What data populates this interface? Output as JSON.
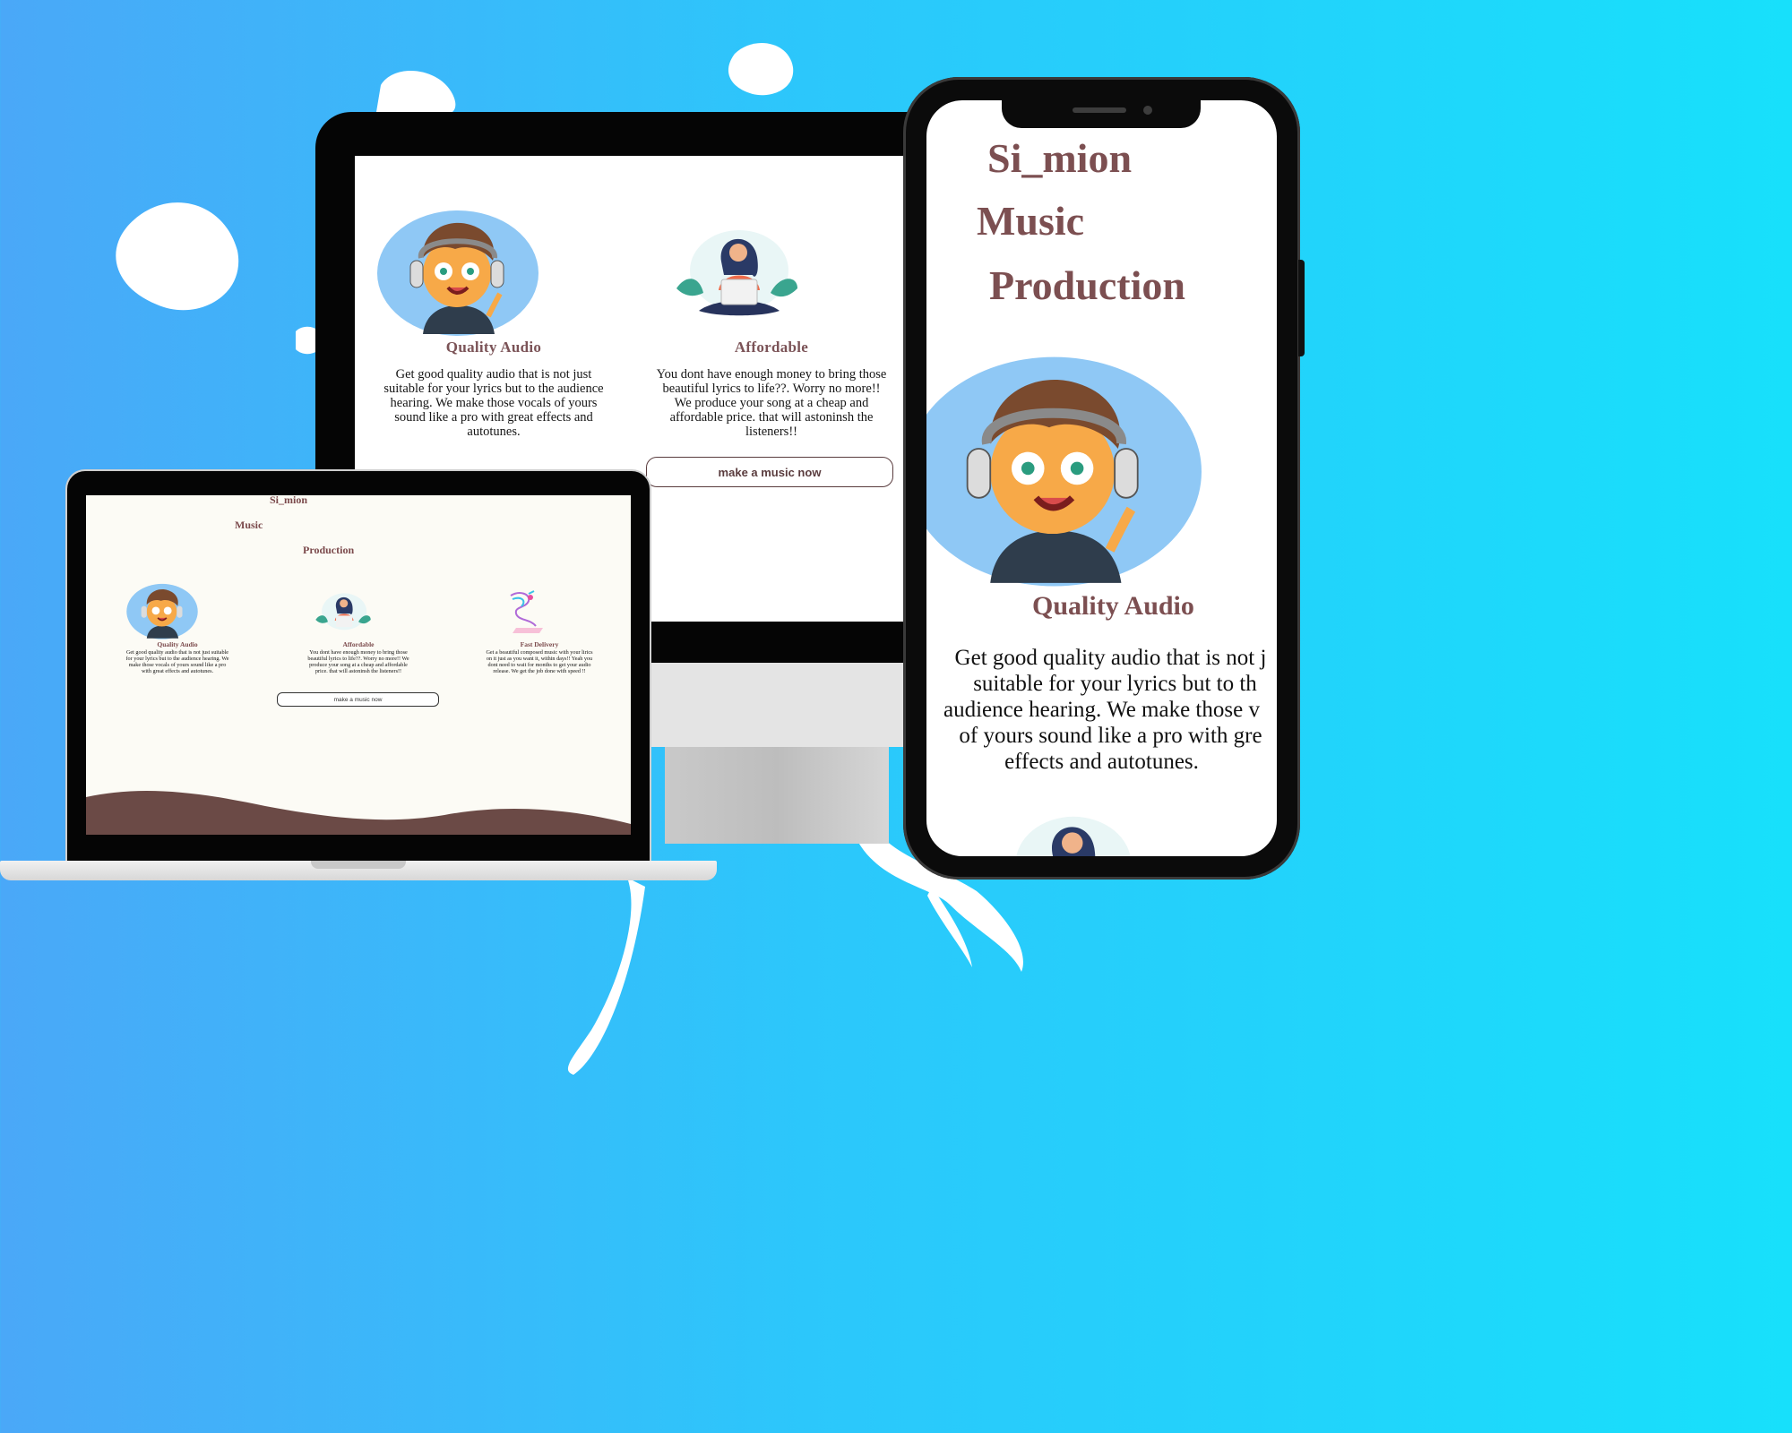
{
  "brand": {
    "line1": "Si_mion",
    "line2": "Music",
    "line3": "Production"
  },
  "features": [
    {
      "title": "Quality Audio",
      "text": "Get good quality audio that is not just suitable for your lyrics but to the audience hearing. We make those vocals of yours sound like a pro with great effects and autotunes."
    },
    {
      "title": "Affordable",
      "text": "You dont have enough money to bring those beautiful lyrics to life??. Worry no more!! We produce your song at a cheap and affordable price. that will astoninsh the listeners!!"
    },
    {
      "title": "Fast Delivery",
      "text": "Get a beautiful composed music with your lirics on it just as you want it, within days!! Yeah you dont need to wait for months to get your audio release. We get the job done with speed !!"
    }
  ],
  "cta": {
    "label": "make a music now"
  },
  "phone": {
    "feature_text_lines": [
      "Get good quality audio that is not j",
      "suitable for your lyrics but to th",
      "audience hearing. We make those v",
      "of yours sound like a pro with gre",
      "effects and autotunes."
    ]
  },
  "colors": {
    "background_left": "#4aa8f8",
    "background_right": "#17e0fb",
    "heading": "#7b5357",
    "footer_wave": "#6b4a46"
  },
  "icons": [
    "boy-headphones-illustration",
    "woman-laptop-illustration",
    "music-delivery-illustration"
  ]
}
